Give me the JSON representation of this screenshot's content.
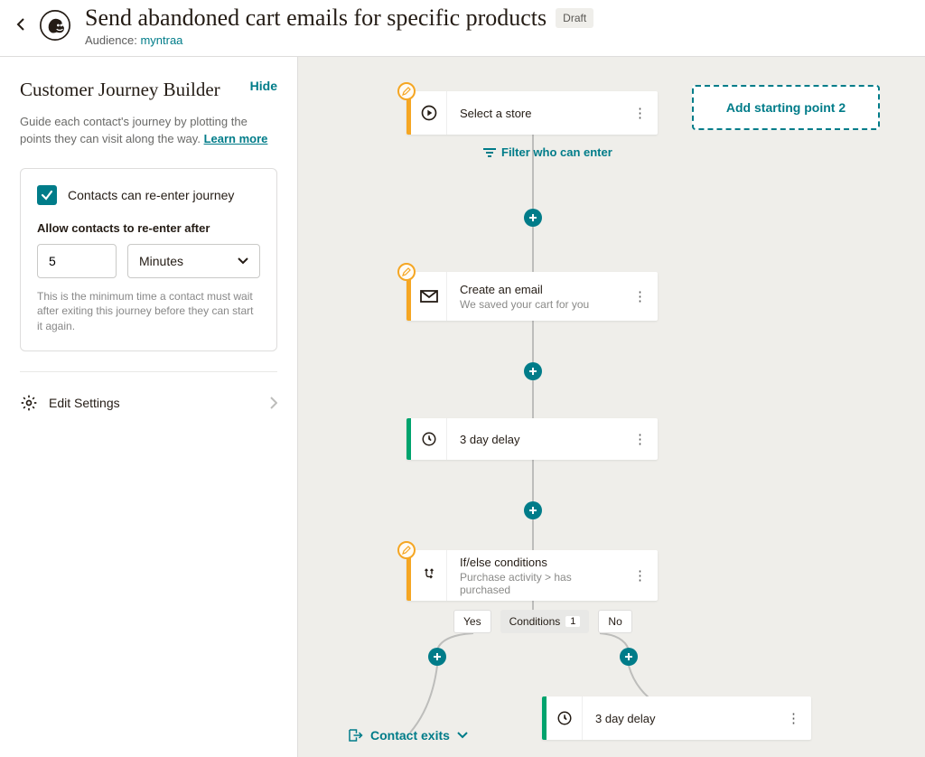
{
  "header": {
    "title": "Send abandoned cart emails for specific products",
    "status_badge": "Draft",
    "audience_label": "Audience:",
    "audience_name": "myntraa"
  },
  "sidebar": {
    "title": "Customer Journey Builder",
    "hide_label": "Hide",
    "description": "Guide each contact's journey by plotting the points they can visit along the way.",
    "learn_more": "Learn more",
    "reenter": {
      "label": "Contacts can re-enter journey",
      "allow_after_label": "Allow contacts to re-enter after",
      "value": "5",
      "unit": "Minutes",
      "helper": "This is the minimum time a contact must wait after exiting this journey before they can start it again."
    },
    "settings_label": "Edit Settings"
  },
  "canvas": {
    "filter_label": "Filter who can enter",
    "add_starting_point": "Add starting point 2",
    "nodes": {
      "start": {
        "title": "Select a store"
      },
      "email": {
        "title": "Create an email",
        "subtitle": "We saved your cart for you"
      },
      "delay1": {
        "title": "3 day delay"
      },
      "ifelse": {
        "title": "If/else conditions",
        "subtitle": "Purchase activity > has purchased"
      },
      "delay2": {
        "title": "3 day delay"
      }
    },
    "branch": {
      "yes": "Yes",
      "conditions_label": "Conditions",
      "conditions_count": "1",
      "no": "No"
    },
    "contact_exits": "Contact exits"
  }
}
